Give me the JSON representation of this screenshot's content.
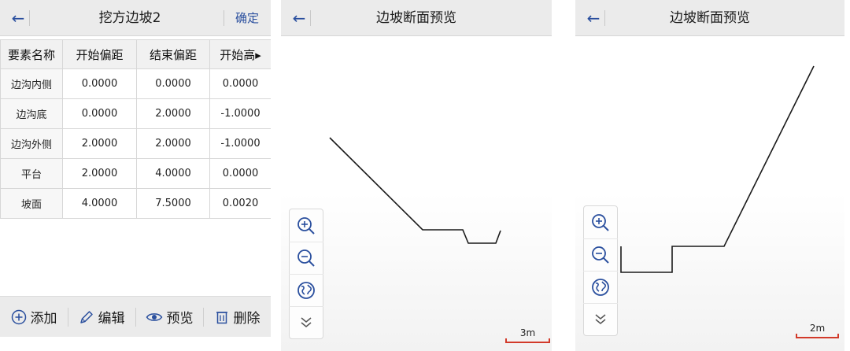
{
  "editor": {
    "back_icon": "arrow-left-icon",
    "title": "挖方边坡2",
    "confirm_label": "确定",
    "columns": [
      "要素名称",
      "开始偏距",
      "结束偏距",
      "开始高▸"
    ],
    "rows": [
      {
        "name": "边沟内侧",
        "start_offset": "0.0000",
        "end_offset": "0.0000",
        "start_height": "0.0000"
      },
      {
        "name": "边沟底",
        "start_offset": "0.0000",
        "end_offset": "2.0000",
        "start_height": "-1.0000"
      },
      {
        "name": "边沟外侧",
        "start_offset": "2.0000",
        "end_offset": "2.0000",
        "start_height": "-1.0000"
      },
      {
        "name": "平台",
        "start_offset": "2.0000",
        "end_offset": "4.0000",
        "start_height": "0.0000"
      },
      {
        "name": "坡面",
        "start_offset": "4.0000",
        "end_offset": "7.5000",
        "start_height": "0.0020"
      }
    ],
    "actions": {
      "add_label": "添加",
      "edit_label": "编辑",
      "preview_label": "预览",
      "delete_label": "删除"
    }
  },
  "previews": [
    {
      "title": "边坡断面预览",
      "scale_label": "3m",
      "zoom_tools": [
        "zoom-in-icon",
        "zoom-out-icon",
        "globe-icon",
        "double-chevron-down-icon"
      ]
    },
    {
      "title": "边坡断面预览",
      "scale_label": "2m",
      "zoom_tools": [
        "zoom-in-icon",
        "zoom-out-icon",
        "globe-icon",
        "double-chevron-down-icon"
      ]
    }
  ],
  "colors": {
    "accent": "#2a4f9e",
    "titlebar": "#ebebeb",
    "scale_bar": "#d23a2a",
    "section_line": "#1a1a1a"
  }
}
